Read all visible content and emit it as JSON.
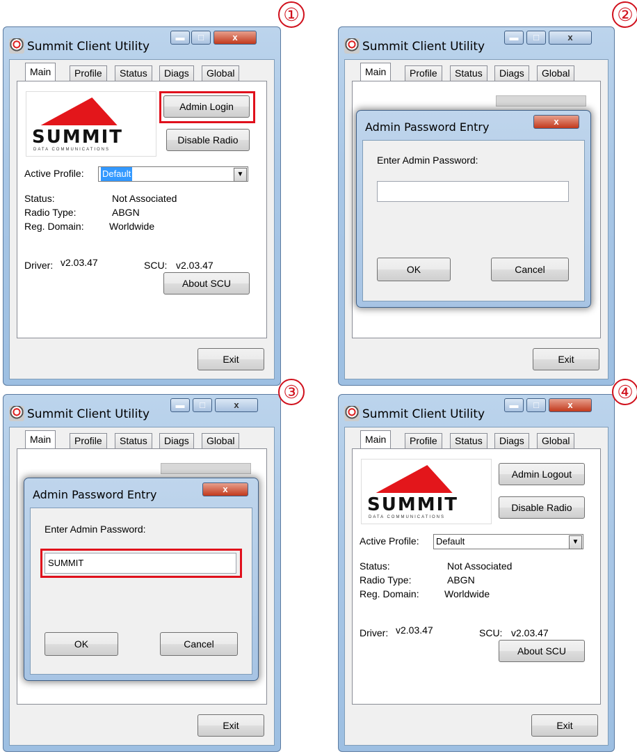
{
  "steps": [
    "①",
    "②",
    "③",
    "④"
  ],
  "window": {
    "title": "Summit Client Utility",
    "close_glyph": "x",
    "min_glyph": "▬",
    "max_glyph": "□"
  },
  "tabs": [
    "Main",
    "Profile",
    "Status",
    "Diags",
    "Global"
  ],
  "logo": {
    "word": "SUMMIT",
    "sub": "DATA COMMUNICATIONS"
  },
  "panel1": {
    "admin_button": "Admin Login",
    "disable_radio": "Disable Radio",
    "active_profile_label": "Active Profile:",
    "active_profile_value": "Default",
    "status_label": "Status:",
    "status_value": "Not Associated",
    "radio_type_label": "Radio Type:",
    "radio_type_value": "ABGN",
    "reg_domain_label": "Reg. Domain:",
    "reg_domain_value": "Worldwide",
    "driver_label": "Driver:",
    "driver_value": "v2.03.47",
    "scu_label": "SCU:",
    "scu_value": "v2.03.47",
    "about": "About SCU",
    "exit": "Exit"
  },
  "dialog": {
    "title": "Admin Password Entry",
    "prompt": "Enter Admin Password:",
    "ok": "OK",
    "cancel": "Cancel",
    "password_empty": "",
    "password_filled": "SUMMIT"
  },
  "panel4": {
    "admin_button": "Admin Logout",
    "disable_radio": "Disable Radio",
    "active_profile_label": "Active Profile:",
    "active_profile_value": "Default",
    "status_label": "Status:",
    "status_value": "Not Associated",
    "radio_type_label": "Radio Type:",
    "radio_type_value": "ABGN",
    "reg_domain_label": "Reg. Domain:",
    "reg_domain_value": "Worldwide",
    "driver_label": "Driver:",
    "driver_value": "v2.03.47",
    "scu_label": "SCU:",
    "scu_value": "v2.03.47",
    "about": "About SCU",
    "exit": "Exit"
  },
  "colors": {
    "highlight": "#e0101c",
    "selection": "#3399ff",
    "brand_red": "#e3161b"
  }
}
